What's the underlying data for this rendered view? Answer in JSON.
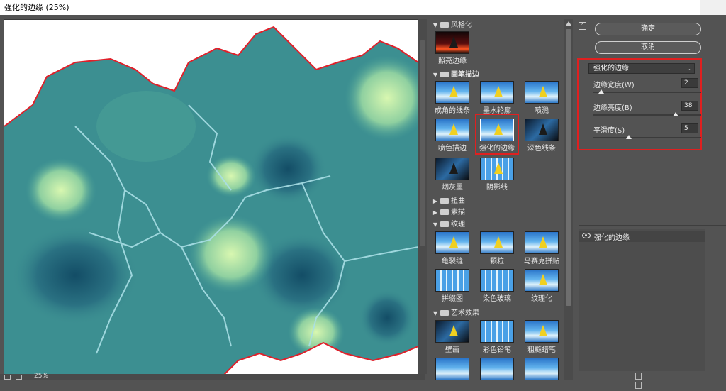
{
  "window": {
    "title": "强化的边缘 (25%)"
  },
  "status": {
    "zoom": "25%"
  },
  "gallery": {
    "categories": [
      {
        "name": "风格化",
        "expanded": true
      },
      {
        "name": "画笔描边",
        "expanded": true
      },
      {
        "name": "扭曲",
        "expanded": false
      },
      {
        "name": "素描",
        "expanded": false
      },
      {
        "name": "纹理",
        "expanded": true
      },
      {
        "name": "艺术效果",
        "expanded": true
      }
    ],
    "stylize": [
      "照亮边缘"
    ],
    "brush": [
      "成角的线条",
      "墨水轮廓",
      "喷溅",
      "喷色描边",
      "强化的边缘",
      "深色线条",
      "烟灰墨",
      "阴影线"
    ],
    "texture": [
      "龟裂缝",
      "颗粒",
      "马赛克拼贴",
      "拼缀图",
      "染色玻璃",
      "纹理化"
    ],
    "artistic": [
      "壁画",
      "彩色铅笔",
      "粗糙蜡笔"
    ],
    "selected": "强化的边缘"
  },
  "buttons": {
    "ok": "确定",
    "cancel": "取消"
  },
  "filter": {
    "selected": "强化的边缘",
    "params": [
      {
        "label": "边缘宽度(W)",
        "value": "2",
        "fraction": 0.07
      },
      {
        "label": "边缘亮度(B)",
        "value": "38",
        "fraction": 0.76
      },
      {
        "label": "平滑度(S)",
        "value": "5",
        "fraction": 0.33
      }
    ]
  },
  "layers": {
    "items": [
      "强化的边缘"
    ]
  },
  "colors": {
    "accent_red": "#e02020",
    "map_teal": "#3c8f91",
    "map_dark": "#1b5a70",
    "map_light": "#c9f0a8"
  }
}
